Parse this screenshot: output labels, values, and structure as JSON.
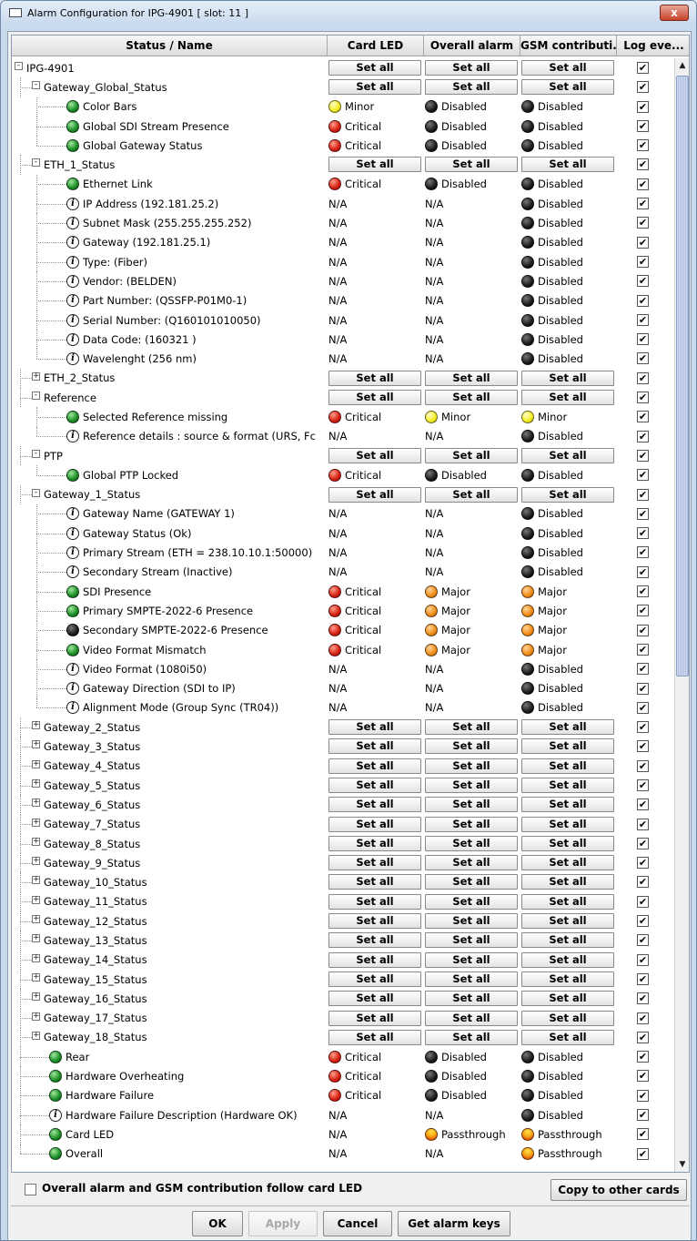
{
  "window": {
    "title": "Alarm Configuration for IPG-4901 [ slot: 11 ]",
    "close_glyph": "x"
  },
  "header": {
    "columns": [
      "Status / Name",
      "Card LED",
      "Overall alarm",
      "GSM contributi...",
      "Log eve..."
    ]
  },
  "rows": [
    {
      "level": 0,
      "toggle": "-",
      "label": "IPG-4901",
      "setall": true,
      "setall_label": "Set all"
    },
    {
      "level": 1,
      "toggle": "-",
      "label": "Gateway_Global_Status",
      "setall": true,
      "setall_label": "Set all"
    },
    {
      "level": 2,
      "icon": "green",
      "label": "Color Bars",
      "led": [
        "yellow",
        "Minor"
      ],
      "ov": [
        "black",
        "Disabled"
      ],
      "gsm": [
        "black",
        "Disabled"
      ]
    },
    {
      "level": 2,
      "icon": "green",
      "label": "Global SDI Stream Presence",
      "led": [
        "red",
        "Critical"
      ],
      "ov": [
        "black",
        "Disabled"
      ],
      "gsm": [
        "black",
        "Disabled"
      ]
    },
    {
      "level": 2,
      "icon": "green",
      "label": "Global Gateway Status",
      "led": [
        "red",
        "Critical"
      ],
      "ov": [
        "black",
        "Disabled"
      ],
      "gsm": [
        "black",
        "Disabled"
      ],
      "last": true
    },
    {
      "level": 1,
      "toggle": "-",
      "label": "ETH_1_Status",
      "setall": true,
      "setall_label": "Set all"
    },
    {
      "level": 2,
      "icon": "green",
      "label": "Ethernet Link",
      "led": [
        "red",
        "Critical"
      ],
      "ov": [
        "black",
        "Disabled"
      ],
      "gsm": [
        "black",
        "Disabled"
      ]
    },
    {
      "level": 2,
      "icon": "info",
      "label": "IP Address (192.181.25.2)",
      "led": [
        "",
        "N/A"
      ],
      "ov": [
        "",
        "N/A"
      ],
      "gsm": [
        "black",
        "Disabled"
      ]
    },
    {
      "level": 2,
      "icon": "info",
      "label": "Subnet Mask (255.255.255.252)",
      "led": [
        "",
        "N/A"
      ],
      "ov": [
        "",
        "N/A"
      ],
      "gsm": [
        "black",
        "Disabled"
      ]
    },
    {
      "level": 2,
      "icon": "info",
      "label": "Gateway (192.181.25.1)",
      "led": [
        "",
        "N/A"
      ],
      "ov": [
        "",
        "N/A"
      ],
      "gsm": [
        "black",
        "Disabled"
      ]
    },
    {
      "level": 2,
      "icon": "info",
      "label": "Type:  (Fiber)",
      "led": [
        "",
        "N/A"
      ],
      "ov": [
        "",
        "N/A"
      ],
      "gsm": [
        "black",
        "Disabled"
      ]
    },
    {
      "level": 2,
      "icon": "info",
      "label": "Vendor:  (BELDEN)",
      "led": [
        "",
        "N/A"
      ],
      "ov": [
        "",
        "N/A"
      ],
      "gsm": [
        "black",
        "Disabled"
      ]
    },
    {
      "level": 2,
      "icon": "info",
      "label": "Part Number:  (QSSFP-P01M0-1)",
      "led": [
        "",
        "N/A"
      ],
      "ov": [
        "",
        "N/A"
      ],
      "gsm": [
        "black",
        "Disabled"
      ]
    },
    {
      "level": 2,
      "icon": "info",
      "label": "Serial Number:  (Q160101010050)",
      "led": [
        "",
        "N/A"
      ],
      "ov": [
        "",
        "N/A"
      ],
      "gsm": [
        "black",
        "Disabled"
      ]
    },
    {
      "level": 2,
      "icon": "info",
      "label": "Data Code:  (160321  )",
      "led": [
        "",
        "N/A"
      ],
      "ov": [
        "",
        "N/A"
      ],
      "gsm": [
        "black",
        "Disabled"
      ]
    },
    {
      "level": 2,
      "icon": "info",
      "label": "Wavelenght (256 nm)",
      "led": [
        "",
        "N/A"
      ],
      "ov": [
        "",
        "N/A"
      ],
      "gsm": [
        "black",
        "Disabled"
      ],
      "last": true
    },
    {
      "level": 1,
      "toggle": "+",
      "label": "ETH_2_Status",
      "setall": true,
      "setall_label": "Set all"
    },
    {
      "level": 1,
      "toggle": "-",
      "label": "Reference",
      "setall": true,
      "setall_label": "Set all"
    },
    {
      "level": 2,
      "icon": "green",
      "label": "Selected Reference missing",
      "led": [
        "red",
        "Critical"
      ],
      "ov": [
        "yellow",
        "Minor"
      ],
      "gsm": [
        "yellow",
        "Minor"
      ]
    },
    {
      "level": 2,
      "icon": "info",
      "label": "Reference details : source & format (URS, Fc",
      "led": [
        "",
        "N/A"
      ],
      "ov": [
        "",
        "N/A"
      ],
      "gsm": [
        "black",
        "Disabled"
      ],
      "last": true
    },
    {
      "level": 1,
      "toggle": "-",
      "label": "PTP",
      "setall": true,
      "setall_label": "Set all"
    },
    {
      "level": 2,
      "icon": "green",
      "label": "Global PTP Locked",
      "led": [
        "red",
        "Critical"
      ],
      "ov": [
        "black",
        "Disabled"
      ],
      "gsm": [
        "black",
        "Disabled"
      ],
      "last": true
    },
    {
      "level": 1,
      "toggle": "-",
      "label": "Gateway_1_Status",
      "setall": true,
      "setall_label": "Set all"
    },
    {
      "level": 2,
      "icon": "info",
      "label": "Gateway Name (GATEWAY 1)",
      "led": [
        "",
        "N/A"
      ],
      "ov": [
        "",
        "N/A"
      ],
      "gsm": [
        "black",
        "Disabled"
      ]
    },
    {
      "level": 2,
      "icon": "info",
      "label": "Gateway Status (Ok)",
      "led": [
        "",
        "N/A"
      ],
      "ov": [
        "",
        "N/A"
      ],
      "gsm": [
        "black",
        "Disabled"
      ]
    },
    {
      "level": 2,
      "icon": "info",
      "label": "Primary Stream (ETH = 238.10.10.1:50000)",
      "led": [
        "",
        "N/A"
      ],
      "ov": [
        "",
        "N/A"
      ],
      "gsm": [
        "black",
        "Disabled"
      ]
    },
    {
      "level": 2,
      "icon": "info",
      "label": "Secondary Stream (Inactive)",
      "led": [
        "",
        "N/A"
      ],
      "ov": [
        "",
        "N/A"
      ],
      "gsm": [
        "black",
        "Disabled"
      ]
    },
    {
      "level": 2,
      "icon": "green",
      "label": "SDI Presence",
      "led": [
        "red",
        "Critical"
      ],
      "ov": [
        "orange",
        "Major"
      ],
      "gsm": [
        "orange",
        "Major"
      ]
    },
    {
      "level": 2,
      "icon": "green",
      "label": "Primary SMPTE-2022-6 Presence",
      "led": [
        "red",
        "Critical"
      ],
      "ov": [
        "orange",
        "Major"
      ],
      "gsm": [
        "orange",
        "Major"
      ]
    },
    {
      "level": 2,
      "icon": "black",
      "label": "Secondary SMPTE-2022-6 Presence",
      "led": [
        "red",
        "Critical"
      ],
      "ov": [
        "orange",
        "Major"
      ],
      "gsm": [
        "orange",
        "Major"
      ]
    },
    {
      "level": 2,
      "icon": "green",
      "label": "Video Format Mismatch",
      "led": [
        "red",
        "Critical"
      ],
      "ov": [
        "orange",
        "Major"
      ],
      "gsm": [
        "orange",
        "Major"
      ]
    },
    {
      "level": 2,
      "icon": "info",
      "label": "Video Format (1080i50)",
      "led": [
        "",
        "N/A"
      ],
      "ov": [
        "",
        "N/A"
      ],
      "gsm": [
        "black",
        "Disabled"
      ]
    },
    {
      "level": 2,
      "icon": "info",
      "label": "Gateway Direction (SDI to IP)",
      "led": [
        "",
        "N/A"
      ],
      "ov": [
        "",
        "N/A"
      ],
      "gsm": [
        "black",
        "Disabled"
      ]
    },
    {
      "level": 2,
      "icon": "info",
      "label": "Alignment Mode (Group Sync (TR04))",
      "led": [
        "",
        "N/A"
      ],
      "ov": [
        "",
        "N/A"
      ],
      "gsm": [
        "black",
        "Disabled"
      ],
      "last": true
    },
    {
      "level": 1,
      "toggle": "+",
      "label": "Gateway_2_Status",
      "setall": true,
      "setall_label": "Set all"
    },
    {
      "level": 1,
      "toggle": "+",
      "label": "Gateway_3_Status",
      "setall": true,
      "setall_label": "Set all"
    },
    {
      "level": 1,
      "toggle": "+",
      "label": "Gateway_4_Status",
      "setall": true,
      "setall_label": "Set all"
    },
    {
      "level": 1,
      "toggle": "+",
      "label": "Gateway_5_Status",
      "setall": true,
      "setall_label": "Set all"
    },
    {
      "level": 1,
      "toggle": "+",
      "label": "Gateway_6_Status",
      "setall": true,
      "setall_label": "Set all"
    },
    {
      "level": 1,
      "toggle": "+",
      "label": "Gateway_7_Status",
      "setall": true,
      "setall_label": "Set all"
    },
    {
      "level": 1,
      "toggle": "+",
      "label": "Gateway_8_Status",
      "setall": true,
      "setall_label": "Set all"
    },
    {
      "level": 1,
      "toggle": "+",
      "label": "Gateway_9_Status",
      "setall": true,
      "setall_label": "Set all"
    },
    {
      "level": 1,
      "toggle": "+",
      "label": "Gateway_10_Status",
      "setall": true,
      "setall_label": "Set all"
    },
    {
      "level": 1,
      "toggle": "+",
      "label": "Gateway_11_Status",
      "setall": true,
      "setall_label": "Set all"
    },
    {
      "level": 1,
      "toggle": "+",
      "label": "Gateway_12_Status",
      "setall": true,
      "setall_label": "Set all"
    },
    {
      "level": 1,
      "toggle": "+",
      "label": "Gateway_13_Status",
      "setall": true,
      "setall_label": "Set all"
    },
    {
      "level": 1,
      "toggle": "+",
      "label": "Gateway_14_Status",
      "setall": true,
      "setall_label": "Set all"
    },
    {
      "level": 1,
      "toggle": "+",
      "label": "Gateway_15_Status",
      "setall": true,
      "setall_label": "Set all"
    },
    {
      "level": 1,
      "toggle": "+",
      "label": "Gateway_16_Status",
      "setall": true,
      "setall_label": "Set all"
    },
    {
      "level": 1,
      "toggle": "+",
      "label": "Gateway_17_Status",
      "setall": true,
      "setall_label": "Set all"
    },
    {
      "level": 1,
      "toggle": "+",
      "label": "Gateway_18_Status",
      "setall": true,
      "setall_label": "Set all"
    },
    {
      "level": 1,
      "icon": "green",
      "label": "Rear",
      "led": [
        "red",
        "Critical"
      ],
      "ov": [
        "black",
        "Disabled"
      ],
      "gsm": [
        "black",
        "Disabled"
      ]
    },
    {
      "level": 1,
      "icon": "green",
      "label": "Hardware Overheating",
      "led": [
        "red",
        "Critical"
      ],
      "ov": [
        "black",
        "Disabled"
      ],
      "gsm": [
        "black",
        "Disabled"
      ]
    },
    {
      "level": 1,
      "icon": "green",
      "label": "Hardware Failure",
      "led": [
        "red",
        "Critical"
      ],
      "ov": [
        "black",
        "Disabled"
      ],
      "gsm": [
        "black",
        "Disabled"
      ]
    },
    {
      "level": 1,
      "icon": "info",
      "label": "Hardware Failure Description (Hardware OK)",
      "led": [
        "",
        "N/A"
      ],
      "ov": [
        "",
        "N/A"
      ],
      "gsm": [
        "black",
        "Disabled"
      ]
    },
    {
      "level": 1,
      "icon": "green",
      "label": "Card LED",
      "led": [
        "",
        "N/A"
      ],
      "ov": [
        "pass",
        "Passthrough"
      ],
      "gsm": [
        "pass",
        "Passthrough"
      ]
    },
    {
      "level": 1,
      "icon": "green",
      "label": "Overall",
      "led": [
        "",
        "N/A"
      ],
      "ov": [
        "",
        "N/A"
      ],
      "gsm": [
        "pass",
        "Passthrough"
      ],
      "last": true
    }
  ],
  "log_checked_glyph": "✔",
  "scrollbar": {
    "up_glyph": "▲",
    "down_glyph": "▼"
  },
  "footer": {
    "follow_label": "Overall alarm and GSM contribution follow card LED",
    "copy_label": "Copy to other cards"
  },
  "buttons": {
    "ok": "OK",
    "apply": "Apply",
    "cancel": "Cancel",
    "keys": "Get alarm keys"
  }
}
